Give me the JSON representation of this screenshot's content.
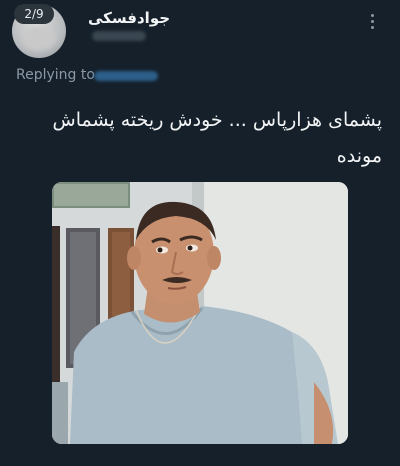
{
  "badge": {
    "page_count": "2/9"
  },
  "author": {
    "display_name": "جوادفسکی"
  },
  "reply": {
    "label": "Replying to"
  },
  "tweet": {
    "text_line1": "پشمای هزارپاس ... خودش ریخته پشماش",
    "text_line2": "مونده"
  },
  "icons": {
    "more": "more-vertical-icon",
    "avatar": "avatar-image"
  },
  "colors": {
    "background": "#15202b",
    "text_primary": "#f2f4f5",
    "text_secondary": "#8b98a5",
    "badge": "#2c343c"
  }
}
